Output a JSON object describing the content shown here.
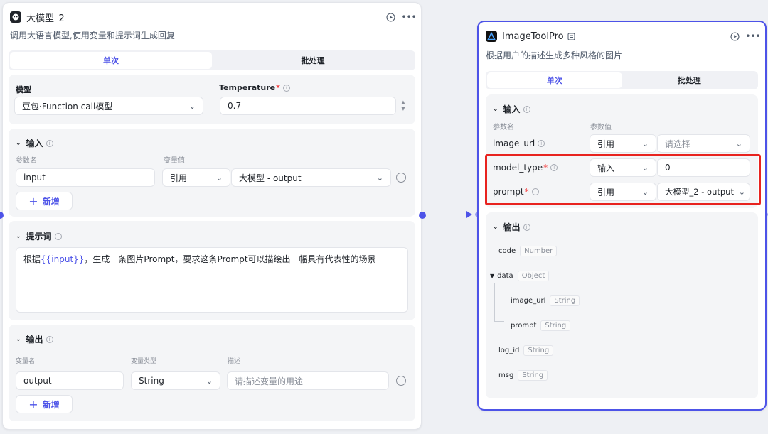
{
  "llm_node": {
    "title": "大模型_2",
    "description": "调用大语言模型,使用变量和提示词生成回复",
    "tabs": [
      "单次",
      "批处理"
    ],
    "model": {
      "label": "模型",
      "value": "豆包·Function call模型"
    },
    "temperature": {
      "label": "Temperature",
      "required": "*",
      "value": "0.7"
    },
    "input": {
      "title": "输入",
      "col_name": "参数名",
      "col_value": "变量值",
      "rows": [
        {
          "name": "input",
          "source": "引用",
          "value": "大模型 - output"
        }
      ],
      "add_label": "新增"
    },
    "prompt": {
      "title": "提示词",
      "text_before": "根据",
      "token": "{{input}}",
      "text_after": "，生成一条图片Prompt，要求这条Prompt可以描绘出一幅具有代表性的场景"
    },
    "output": {
      "title": "输出",
      "col_name": "变量名",
      "col_type": "变量类型",
      "col_desc": "描述",
      "rows": [
        {
          "name": "output",
          "type": "String",
          "desc_placeholder": "请描述变量的用途"
        }
      ],
      "add_label": "新增"
    }
  },
  "tool_node": {
    "title": "ImageToolPro",
    "description": "根据用户的描述生成多种风格的图片",
    "tabs": [
      "单次",
      "批处理"
    ],
    "input": {
      "title": "输入",
      "col_name": "参数名",
      "col_value": "参数值",
      "rows": [
        {
          "name": "image_url",
          "required": "",
          "source": "引用",
          "value": "请选择"
        },
        {
          "name": "model_type",
          "required": "*",
          "source": "输入",
          "value": "0"
        },
        {
          "name": "prompt",
          "required": "*",
          "source": "引用",
          "value": "大模型_2 - output"
        }
      ]
    },
    "output": {
      "title": "输出",
      "fields": [
        {
          "name": "code",
          "type": "Number"
        },
        {
          "name": "data",
          "type": "Object"
        },
        {
          "name": "image_url",
          "type": "String"
        },
        {
          "name": "prompt",
          "type": "String"
        },
        {
          "name": "log_id",
          "type": "String"
        },
        {
          "name": "msg",
          "type": "String"
        }
      ]
    }
  },
  "colors": {
    "accent": "#4d53e8",
    "highlight": "#e8231f",
    "required": "#f53f3f"
  }
}
